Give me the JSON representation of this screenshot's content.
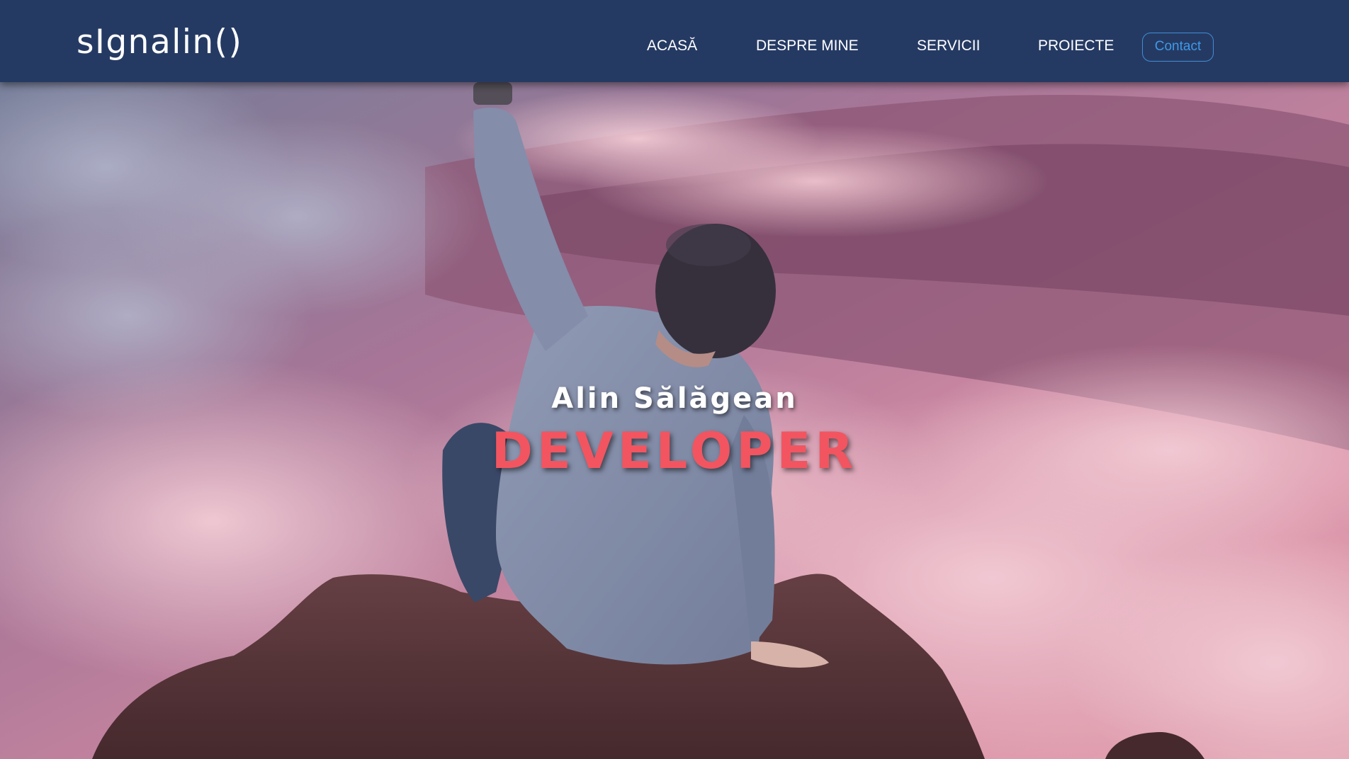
{
  "header": {
    "logo": "sIgnalin()",
    "nav": [
      {
        "label": "ACASĂ"
      },
      {
        "label": "DESPRE MINE"
      },
      {
        "label": "SERVICII"
      },
      {
        "label": "PROIECTE"
      }
    ],
    "contact_label": "Contact"
  },
  "hero": {
    "name": "Alin Sălăgean",
    "role": "DEVELOPER"
  },
  "colors": {
    "header_bg": "#253a63",
    "role_accent": "#f25560",
    "contact_border": "#3f8fd6"
  }
}
